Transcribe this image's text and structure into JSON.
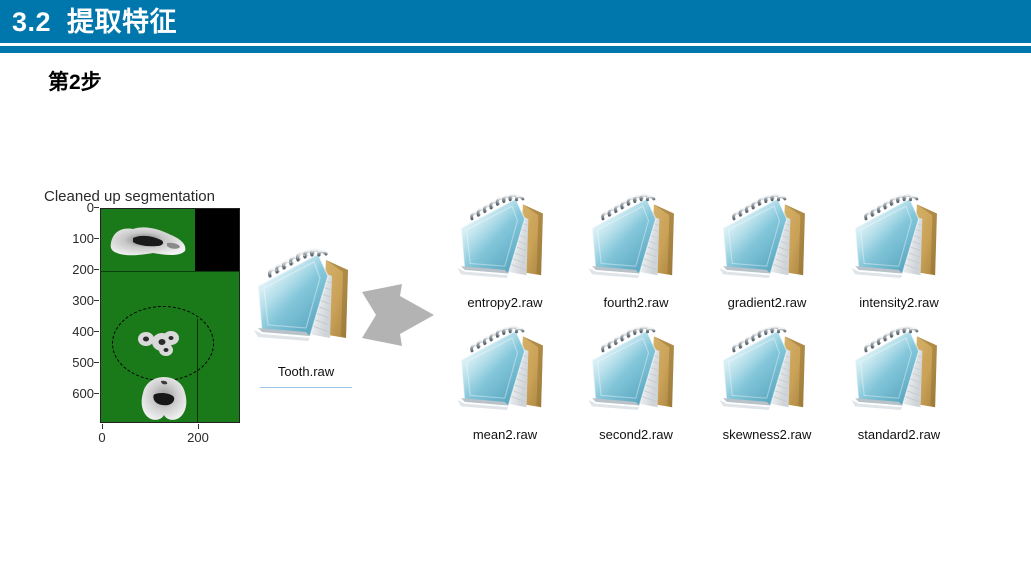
{
  "header": {
    "number": "3.2",
    "title": "3.2  提取特征",
    "band_color": "#0077ac",
    "text_color": "#ffffff"
  },
  "subtitle": {
    "label": "第2步"
  },
  "figure": {
    "title": "Cleaned up segmentation",
    "plot_bg_color": "#1a7a1a",
    "mask_color": "#000000",
    "y_ticks": [
      "0",
      "100",
      "200",
      "300",
      "400",
      "500",
      "600"
    ],
    "x_ticks": [
      "0",
      "200"
    ],
    "annotation": "dashed-ellipse-roi"
  },
  "source_file": {
    "label": "Tooth.raw",
    "icon": "notepad-icon",
    "underline_color": "#9dc3e6"
  },
  "arrow": {
    "name": "process-arrow",
    "color": "#b0b0b0"
  },
  "outputs": {
    "icon": "notepad-icon",
    "rows": [
      {
        "items": [
          {
            "label": "entropy2.raw"
          },
          {
            "label": "fourth2.raw"
          },
          {
            "label": "gradient2.raw"
          },
          {
            "label": "intensity2.raw"
          }
        ]
      },
      {
        "items": [
          {
            "label": "mean2.raw"
          },
          {
            "label": "second2.raw"
          },
          {
            "label": "skewness2.raw"
          },
          {
            "label": "standard2.raw"
          }
        ]
      }
    ]
  },
  "chart_data": {
    "type": "heatmap",
    "title": "Cleaned up segmentation",
    "xlabel": "",
    "ylabel": "",
    "xlim": [
      0,
      260
    ],
    "ylim": [
      700,
      0
    ],
    "x_ticks": [
      0,
      200
    ],
    "y_ticks": [
      0,
      100,
      200,
      300,
      400,
      500,
      600
    ],
    "grid": false,
    "legend": "none",
    "regions": [
      {
        "name": "background-segmentation",
        "color": "#1a7a1a",
        "value": 1
      },
      {
        "name": "masked-out-corner",
        "color": "#000000",
        "value": 0
      },
      {
        "name": "tooth-crown-upper",
        "color": "grayscale",
        "y_center": 110
      },
      {
        "name": "tooth-roots-middle",
        "color": "grayscale",
        "y_center": 380
      },
      {
        "name": "tooth-molar-lower",
        "color": "grayscale",
        "y_center": 610
      }
    ]
  }
}
